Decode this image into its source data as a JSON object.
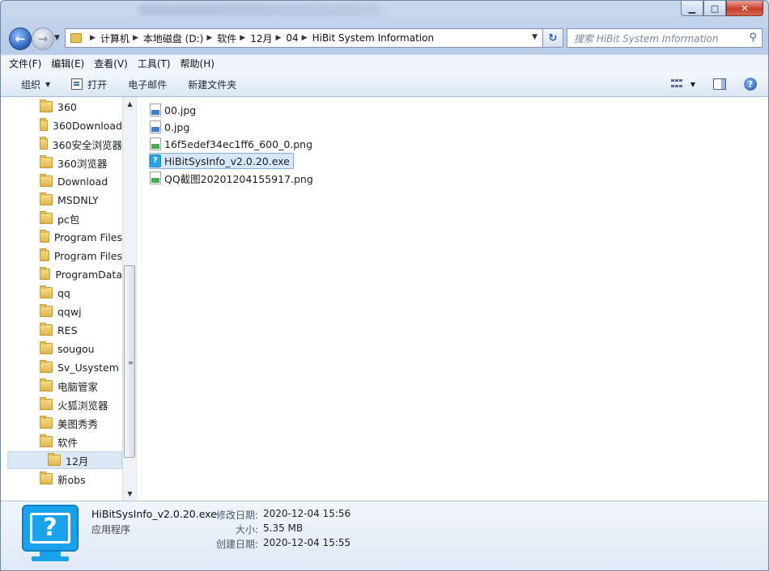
{
  "window": {
    "controls": {
      "minimize": "▁",
      "maximize": "□",
      "close": "✕"
    }
  },
  "nav": {
    "back_icon": "back-arrow-icon",
    "forward_icon": "forward-arrow-icon",
    "breadcrumbs": [
      "计算机",
      "本地磁盘 (D:)",
      "软件",
      "12月",
      "04",
      "HiBit System Information"
    ],
    "search_placeholder": "搜索 HiBit System Information"
  },
  "menu": [
    "文件(F)",
    "编辑(E)",
    "查看(V)",
    "工具(T)",
    "帮助(H)"
  ],
  "toolbar": {
    "organize": "组织",
    "open": "打开",
    "email": "电子邮件",
    "new_folder": "新建文件夹"
  },
  "tree": [
    {
      "label": "360"
    },
    {
      "label": "360Download"
    },
    {
      "label": "360安全浏览器"
    },
    {
      "label": "360浏览器"
    },
    {
      "label": "Download"
    },
    {
      "label": "MSDNLY"
    },
    {
      "label": "pc包"
    },
    {
      "label": "Program Files"
    },
    {
      "label": "Program Files"
    },
    {
      "label": "ProgramData"
    },
    {
      "label": "qq"
    },
    {
      "label": "qqwj"
    },
    {
      "label": "RES"
    },
    {
      "label": "sougou"
    },
    {
      "label": "Sv_Usystem"
    },
    {
      "label": "电脑管家"
    },
    {
      "label": "火狐浏览器"
    },
    {
      "label": "美图秀秀"
    },
    {
      "label": "软件"
    },
    {
      "label": "12月"
    },
    {
      "label": "新obs"
    }
  ],
  "files": [
    {
      "name": "00.jpg",
      "type": "jpg"
    },
    {
      "name": "0.jpg",
      "type": "jpg"
    },
    {
      "name": "16f5edef34ec1ff6_600_0.png",
      "type": "png"
    },
    {
      "name": "HiBitSysInfo_v2.0.20.exe",
      "type": "exe"
    },
    {
      "name": "QQ截图20201204155917.png",
      "type": "png"
    }
  ],
  "details": {
    "name": "HiBitSysInfo_v2.0.20.exe",
    "type": "应用程序",
    "modified_label": "修改日期:",
    "modified": "2020-12-04 15:56",
    "size_label": "大小:",
    "size": "5.35 MB",
    "created_label": "创建日期:",
    "created": "2020-12-04 15:55"
  }
}
